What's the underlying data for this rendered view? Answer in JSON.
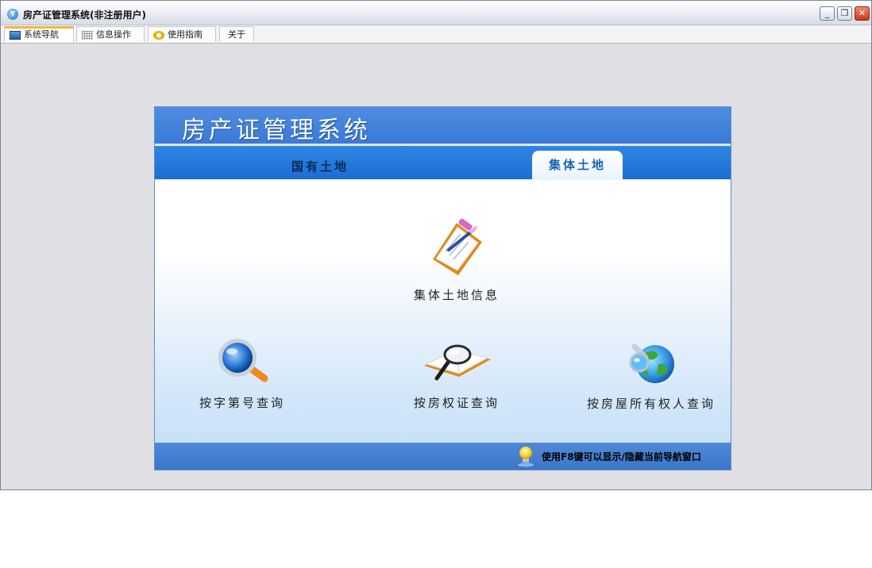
{
  "window": {
    "title": "房产证管理系统(非注册用户)"
  },
  "tabs": [
    {
      "label": "系统导航",
      "active": true,
      "icon": "nav-icon"
    },
    {
      "label": "信息操作",
      "active": false,
      "icon": "grid-icon"
    },
    {
      "label": "使用指南",
      "active": false,
      "icon": "help-icon"
    },
    {
      "label": "关于",
      "active": false,
      "icon": ""
    }
  ],
  "panel": {
    "title": "房产证管理系统",
    "tabs": [
      {
        "label": "国有土地",
        "active": false
      },
      {
        "label": "集体土地",
        "active": true
      }
    ],
    "items": {
      "info": {
        "label": "集体土地信息",
        "icon": "clipboard-icon"
      },
      "by_number": {
        "label": "按字第号查询",
        "icon": "magnifier-icon"
      },
      "by_cert": {
        "label": "按房权证查询",
        "icon": "book-search-icon"
      },
      "by_owner": {
        "label": "按房屋所有权人查询",
        "icon": "globe-search-icon"
      }
    },
    "footer": {
      "hint": "使用F8键可以显示/隐藏当前导航窗口",
      "icon": "bulb-icon"
    }
  },
  "colors": {
    "header": "#4f8de0",
    "tabstrip": "#1d6dd2",
    "active_tab_text": "#1863b8",
    "footer": "#4f89d6"
  }
}
